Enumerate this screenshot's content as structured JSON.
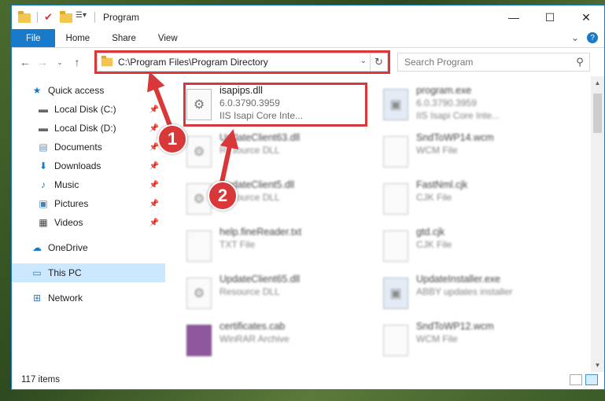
{
  "window": {
    "title": "Program"
  },
  "ribbon": {
    "tabs": [
      "File",
      "Home",
      "Share",
      "View"
    ]
  },
  "address": {
    "path": "C:\\Program Files\\Program Directory",
    "search_placeholder": "Search Program"
  },
  "sidebar": {
    "items": [
      {
        "label": "Quick access",
        "icon": "star-icon"
      },
      {
        "label": "Local Disk (C:)",
        "icon": "drive-icon"
      },
      {
        "label": "Local Disk (D:)",
        "icon": "drive-icon"
      },
      {
        "label": "Documents",
        "icon": "documents-icon"
      },
      {
        "label": "Downloads",
        "icon": "download-arrow-icon"
      },
      {
        "label": "Music",
        "icon": "music-note-icon"
      },
      {
        "label": "Pictures",
        "icon": "pictures-icon"
      },
      {
        "label": "Videos",
        "icon": "film-icon"
      },
      {
        "label": "OneDrive",
        "icon": "cloud-icon"
      },
      {
        "label": "This PC",
        "icon": "monitor-icon"
      },
      {
        "label": "Network",
        "icon": "network-icon"
      }
    ]
  },
  "files": [
    {
      "name": "isapips.dll",
      "l2": "6.0.3790.3959",
      "l3": "IIS Isapi Core Inte...",
      "type": "dll"
    },
    {
      "name": "program.exe",
      "l2": "6.0.3790.3959",
      "l3": "IIS Isapi Core Inte...",
      "type": "exe"
    },
    {
      "name": "UpdateClient63.dll",
      "l2": "Resource DLL",
      "l3": "",
      "type": "dll"
    },
    {
      "name": "SndToWP14.wcm",
      "l2": "WCM File",
      "l3": "",
      "type": "doc"
    },
    {
      "name": "UpdateClient5.dll",
      "l2": "Resource DLL",
      "l3": "",
      "type": "dll"
    },
    {
      "name": "FastNml.cjk",
      "l2": "CJK File",
      "l3": "",
      "type": "doc"
    },
    {
      "name": "help.fineReader.txt",
      "l2": "TXT File",
      "l3": "",
      "type": "doc"
    },
    {
      "name": "gtd.cjk",
      "l2": "CJK File",
      "l3": "",
      "type": "doc"
    },
    {
      "name": "UpdateClient65.dll",
      "l2": "Resource DLL",
      "l3": "",
      "type": "dll"
    },
    {
      "name": "UpdateInstaller.exe",
      "l2": "ABBY updates installer",
      "l3": "",
      "type": "exe"
    },
    {
      "name": "certificates.cab",
      "l2": "WinRAR Archive",
      "l3": "",
      "type": "cab"
    },
    {
      "name": "SndToWP12.wcm",
      "l2": "WCM File",
      "l3": "",
      "type": "doc"
    }
  ],
  "status": {
    "items": "117 items"
  },
  "callouts": {
    "one": "1",
    "two": "2"
  },
  "colors": {
    "accent": "#1979ca",
    "highlight_red": "#d9383a",
    "selected_bg": "#cce8ff"
  }
}
